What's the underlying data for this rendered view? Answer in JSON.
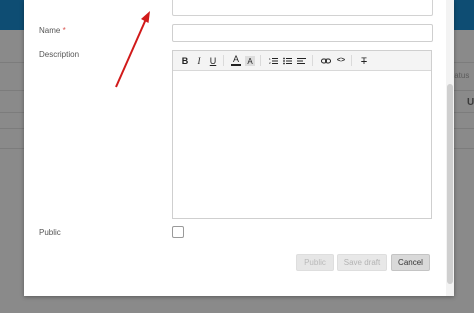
{
  "background": {
    "status_fragment": "tatus",
    "column_fragment": "U"
  },
  "form": {
    "name_label": "Name",
    "required_mark": "*",
    "name_value": "",
    "description_label": "Description",
    "public_label": "Public",
    "public_checked": false
  },
  "toolbar": {
    "bold": "B",
    "italic": "I",
    "underline": "U",
    "font_color": "A",
    "bg_color": "A",
    "ordered_list": "≡",
    "bullet_list": "☰",
    "align": "≡",
    "link": "🔗",
    "code": "<>",
    "clear_format": "T"
  },
  "buttons": {
    "public": "Public",
    "save_draft": "Save draft",
    "cancel": "Cancel"
  },
  "annotation": {
    "color": "#d11a1a"
  }
}
